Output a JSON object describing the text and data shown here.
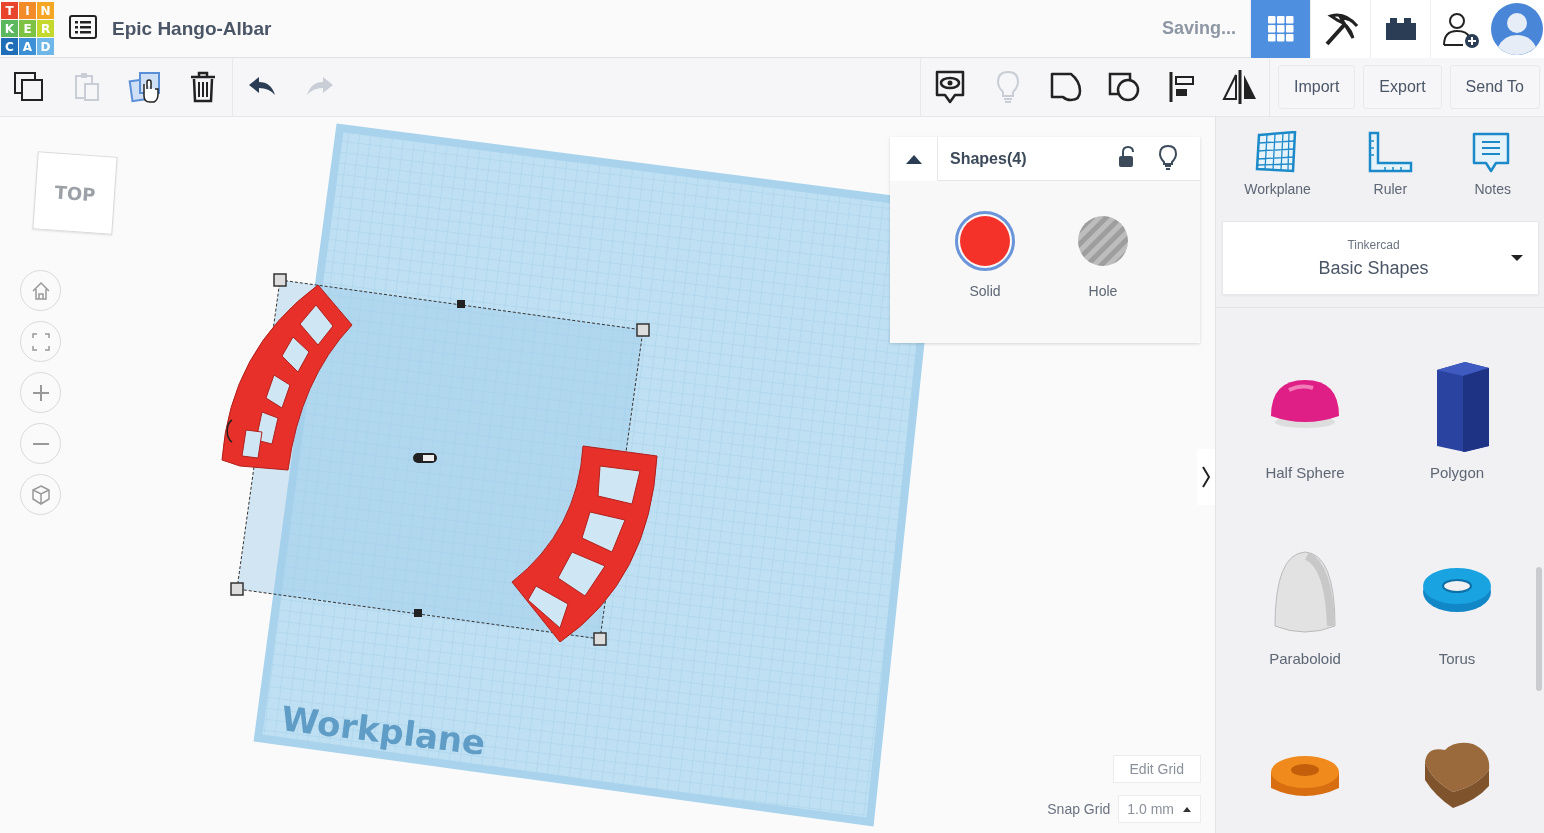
{
  "header": {
    "logo": [
      {
        "letter": "T",
        "color": "#e8452c"
      },
      {
        "letter": "I",
        "color": "#f28c28"
      },
      {
        "letter": "N",
        "color": "#f5a623"
      },
      {
        "letter": "K",
        "color": "#5cb85c"
      },
      {
        "letter": "E",
        "color": "#7dc242"
      },
      {
        "letter": "R",
        "color": "#c4d82e"
      },
      {
        "letter": "C",
        "color": "#1f6fb8"
      },
      {
        "letter": "A",
        "color": "#3d8fd6"
      },
      {
        "letter": "D",
        "color": "#6fb7e8"
      }
    ],
    "title": "Epic Hango-Albar",
    "status": "Saving...",
    "views": [
      {
        "kind": "grid",
        "selected": true
      },
      {
        "kind": "pickaxe",
        "selected": false
      },
      {
        "kind": "brick",
        "selected": false
      }
    ]
  },
  "toolbar": {
    "edit_tools": [
      {
        "kind": "copy",
        "disabled": false
      },
      {
        "kind": "paste",
        "disabled": true
      },
      {
        "kind": "duplicate",
        "disabled": false
      },
      {
        "kind": "delete",
        "disabled": false
      },
      {
        "kind": "undo",
        "disabled": false
      },
      {
        "kind": "redo",
        "disabled": true
      }
    ],
    "shape_tools": [
      {
        "kind": "show",
        "disabled": false
      },
      {
        "kind": "light",
        "disabled": true
      },
      {
        "kind": "group",
        "disabled": false
      },
      {
        "kind": "ungroup",
        "disabled": false
      },
      {
        "kind": "align",
        "disabled": false
      },
      {
        "kind": "mirror",
        "disabled": false
      }
    ],
    "buttons": [
      "Import",
      "Export",
      "Send To"
    ]
  },
  "canvas": {
    "view_cube": "TOP",
    "workplane_label": "Workplane",
    "inspector": {
      "title": "Shapes(4)",
      "options": [
        {
          "label": "Solid",
          "kind": "solid",
          "selected": true
        },
        {
          "label": "Hole",
          "kind": "hole",
          "selected": false
        }
      ]
    },
    "edit_grid": "Edit Grid",
    "snap_grid": {
      "label": "Snap Grid",
      "value": "1.0 mm"
    }
  },
  "panel": {
    "tools": [
      {
        "label": "Workplane",
        "kind": "workplane"
      },
      {
        "label": "Ruler",
        "kind": "ruler"
      },
      {
        "label": "Notes",
        "kind": "notes"
      }
    ],
    "library": {
      "source": "Tinkercad",
      "name": "Basic Shapes"
    },
    "shapes": [
      {
        "label": "Half Sphere",
        "kind": "half-sphere"
      },
      {
        "label": "Polygon",
        "kind": "polygon"
      },
      {
        "label": "Paraboloid",
        "kind": "paraboloid"
      },
      {
        "label": "Torus",
        "kind": "torus"
      },
      {
        "kind": "tube"
      },
      {
        "kind": "heart"
      }
    ]
  }
}
